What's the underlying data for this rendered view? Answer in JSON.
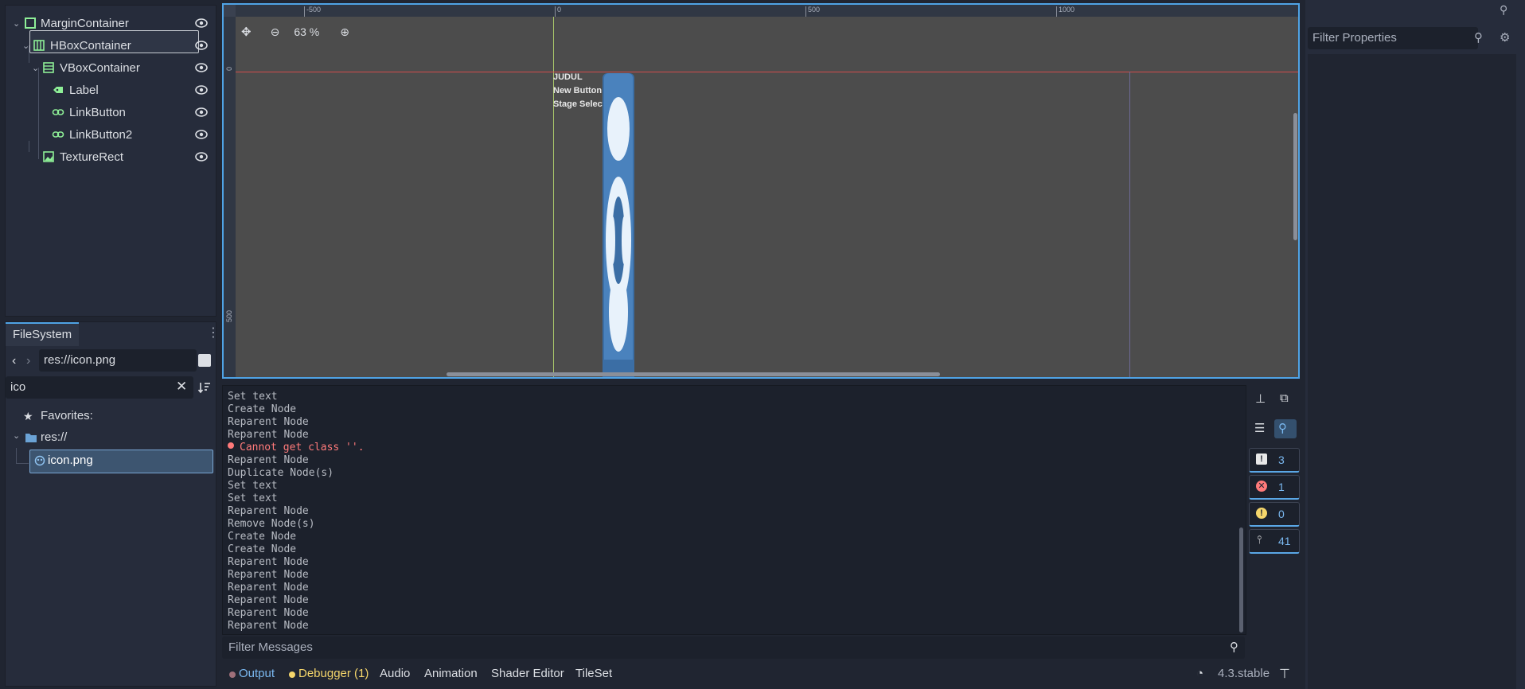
{
  "scene_tree": {
    "nodes": [
      {
        "label": "MarginContainer",
        "type": "margin"
      },
      {
        "label": "HBoxContainer",
        "type": "hbox"
      },
      {
        "label": "VBoxContainer",
        "type": "vbox"
      },
      {
        "label": "Label",
        "type": "label"
      },
      {
        "label": "LinkButton",
        "type": "link"
      },
      {
        "label": "LinkButton2",
        "type": "link"
      },
      {
        "label": "TextureRect",
        "type": "texture"
      }
    ]
  },
  "filesystem": {
    "tab_label": "FileSystem",
    "path_value": "res://icon.png",
    "search_value": "ico",
    "favorites_label": "Favorites:",
    "root_label": "res://",
    "file_label": "icon.png"
  },
  "viewport": {
    "zoom_label": "63 %",
    "ruler_top": [
      "-500",
      "0",
      "500",
      "1000"
    ],
    "ruler_left": [
      "0",
      "500"
    ],
    "ui_texts": [
      "JUDUL",
      "New Button",
      "Stage Select"
    ]
  },
  "output": {
    "lines": [
      {
        "text": "Set text",
        "error": false
      },
      {
        "text": "Create Node",
        "error": false
      },
      {
        "text": "Reparent Node",
        "error": false
      },
      {
        "text": "Reparent Node",
        "error": false
      },
      {
        "text": "Cannot get class ''.",
        "error": true
      },
      {
        "text": "Reparent Node",
        "error": false
      },
      {
        "text": "Duplicate Node(s)",
        "error": false
      },
      {
        "text": "Set text",
        "error": false
      },
      {
        "text": "Set text",
        "error": false
      },
      {
        "text": "Reparent Node",
        "error": false
      },
      {
        "text": "Remove Node(s)",
        "error": false
      },
      {
        "text": "Create Node",
        "error": false
      },
      {
        "text": "Create Node",
        "error": false
      },
      {
        "text": "Reparent Node",
        "error": false
      },
      {
        "text": "Reparent Node",
        "error": false
      },
      {
        "text": "Reparent Node",
        "error": false
      },
      {
        "text": "Reparent Node",
        "error": false
      },
      {
        "text": "Reparent Node",
        "error": false
      },
      {
        "text": "Reparent Node",
        "error": false
      }
    ],
    "counts": {
      "messages": "3",
      "errors": "1",
      "warnings": "0",
      "editor": "41"
    },
    "filter_placeholder": "Filter Messages"
  },
  "bottom_tabs": {
    "output": "Output",
    "debugger": "Debugger (1)",
    "audio": "Audio",
    "animation": "Animation",
    "shader_editor": "Shader Editor",
    "tileset": "TileSet",
    "version": "4.3.stable"
  },
  "inspector": {
    "filter_placeholder": "Filter Properties"
  },
  "colors": {
    "accent": "#4fa3e5",
    "error": "#ff7a7a",
    "debugger": "#f5d66b",
    "node_green": "#8eef97",
    "panel": "#262c3b"
  }
}
